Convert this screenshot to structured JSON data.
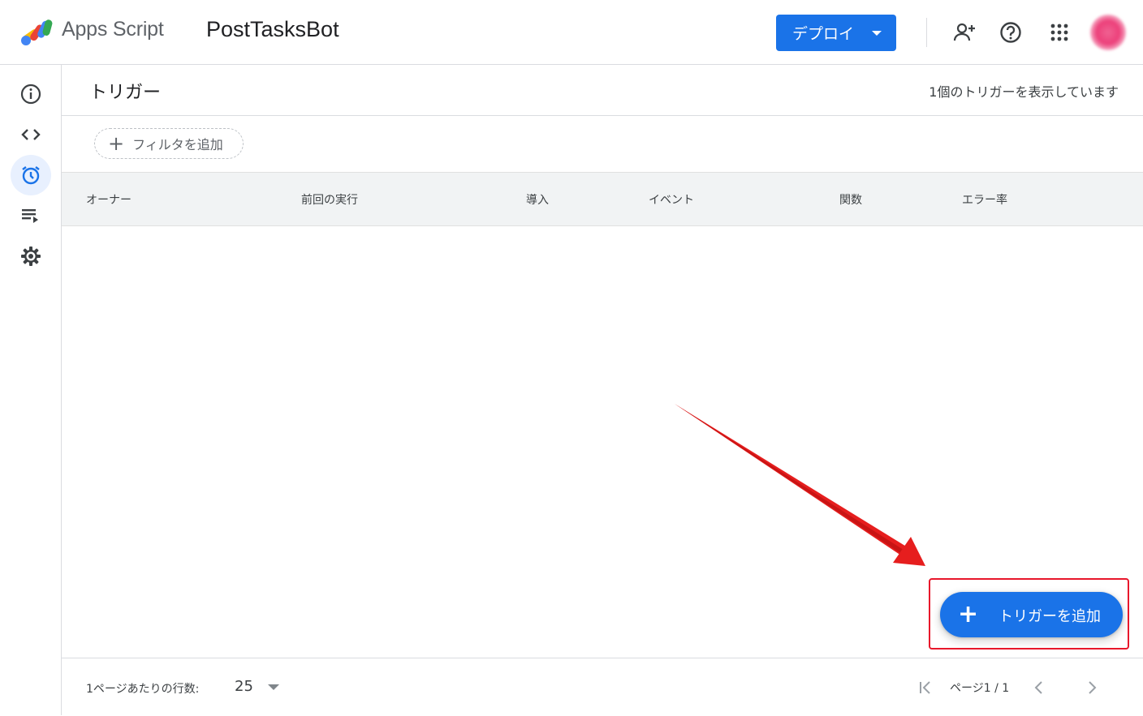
{
  "topbar": {
    "app_name": "Apps Script",
    "project_name": "PostTasksBot",
    "deploy_label": "デプロイ",
    "icons": [
      "share-person-add-icon",
      "help-icon",
      "apps-grid-icon"
    ],
    "accent_color": "#1a73e8"
  },
  "sidenav": {
    "items": [
      {
        "icon": "info-icon"
      },
      {
        "icon": "code-icon"
      },
      {
        "icon": "alarm-clock-icon",
        "active": true
      },
      {
        "icon": "executions-icon"
      },
      {
        "icon": "gear-icon"
      }
    ]
  },
  "page": {
    "title": "トリガー",
    "count_text": "1個のトリガーを表示しています",
    "filter_label": "フィルタを追加"
  },
  "table": {
    "columns": [
      "オーナー",
      "前回の実行",
      "導入",
      "イベント",
      "関数",
      "エラー率"
    ],
    "rows": []
  },
  "footer": {
    "rows_per_page_label": "1ページあたりの行数:",
    "rows_per_page_value": "25",
    "page_indicator": "ページ1 / 1"
  },
  "fab": {
    "label": "トリガーを追加"
  },
  "annotation": {
    "color": "#e8172b"
  }
}
